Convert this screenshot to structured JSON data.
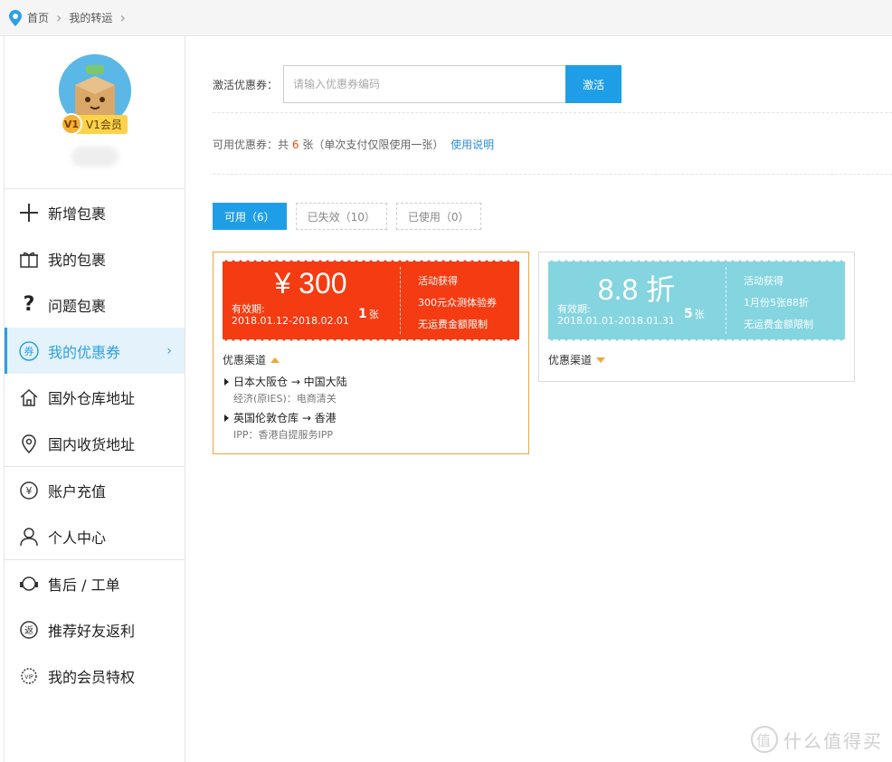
{
  "breadcrumb": {
    "home": "首页",
    "current": "我的转运"
  },
  "profile": {
    "vip_level": "V1",
    "vip_label": "V1会员"
  },
  "nav_groups": [
    [
      {
        "label": "新增包裹",
        "icon": "plus-icon"
      },
      {
        "label": "我的包裹",
        "icon": "gift-icon"
      },
      {
        "label": "问题包裹",
        "icon": "question-icon"
      },
      {
        "label": "我的优惠券",
        "icon": "coupon-icon",
        "active": true
      },
      {
        "label": "国外仓库地址",
        "icon": "home-icon"
      },
      {
        "label": "国内收货地址",
        "icon": "location-pin-icon"
      }
    ],
    [
      {
        "label": "账户充值",
        "icon": "yen-icon"
      },
      {
        "label": "个人中心",
        "icon": "user-icon"
      }
    ],
    [
      {
        "label": "售后 / 工单",
        "icon": "headset-icon"
      },
      {
        "label": "推荐好友返利",
        "icon": "rebate-icon"
      },
      {
        "label": "我的会员特权",
        "icon": "vip-medal-icon"
      }
    ]
  ],
  "activate": {
    "label": "激活优惠券：",
    "placeholder": "请输入优惠券编码",
    "button": "激活"
  },
  "available": {
    "prefix": "可用优惠券：共",
    "count": "6",
    "suffix": "张（单次支付仅限使用一张）",
    "link": "使用说明"
  },
  "tabs": [
    {
      "label": "可用（6）",
      "active": true
    },
    {
      "label": "已失效（10）"
    },
    {
      "label": "已使用（0）"
    }
  ],
  "coupons": [
    {
      "value": "¥ 300",
      "valid_label": "有效期:",
      "dates": "2018.01.12-2018.02.01",
      "count": "1",
      "count_unit": "张",
      "side": [
        "活动获得",
        "300元众测体验券",
        "无运费金额限制"
      ],
      "channel_label": "优惠渠道",
      "routes": [
        {
          "title": "日本大阪仓 → 中国大陆",
          "sub": "经济(原IES)：电商清关"
        },
        {
          "title": "英国伦敦仓库 → 香港",
          "sub": "IPP：香港自提服务IPP"
        }
      ],
      "color": "#f53b12"
    },
    {
      "value": "8.8 折",
      "valid_label": "有效期:",
      "dates": "2018.01.01-2018.01.31",
      "count": "5",
      "count_unit": "张",
      "side": [
        "活动获得",
        "1月份5张88折",
        "无运费金额限制"
      ],
      "channel_label": "优惠渠道",
      "color": "#84d5e0"
    }
  ],
  "watermark": {
    "text": "什么值得买",
    "icon_text": "值"
  },
  "colors": {
    "accent": "#1f9ee8",
    "coupon_red": "#f53b12",
    "coupon_teal": "#84d5e0",
    "selected_border": "#f2a53a"
  }
}
